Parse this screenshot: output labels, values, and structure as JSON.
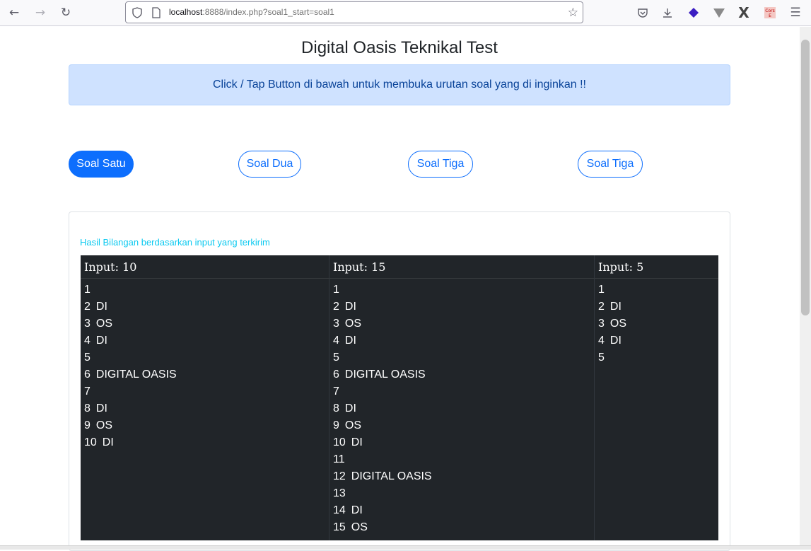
{
  "browser": {
    "url_host": "localhost",
    "url_rest": ":8888/index.php?soal1_start=soal1"
  },
  "page": {
    "title": "Digital Oasis Teknikal Test",
    "alert": "Click / Tap Button di bawah untuk membuka urutan soal yang di inginkan !!",
    "buttons": [
      {
        "label": "Soal Satu",
        "active": true
      },
      {
        "label": "Soal Dua",
        "active": false
      },
      {
        "label": "Soal Tiga",
        "active": false
      },
      {
        "label": "Soal Tiga",
        "active": false
      }
    ],
    "result_caption": "Hasil Bilangan berdasarkan input yang terkirim",
    "columns": [
      {
        "header": "Input: 10",
        "rows": [
          {
            "n": "1",
            "w": ""
          },
          {
            "n": "2",
            "w": "DI"
          },
          {
            "n": "3",
            "w": "OS"
          },
          {
            "n": "4",
            "w": "DI"
          },
          {
            "n": "5",
            "w": ""
          },
          {
            "n": "6",
            "w": "DIGITAL OASIS"
          },
          {
            "n": "7",
            "w": ""
          },
          {
            "n": "8",
            "w": "DI"
          },
          {
            "n": "9",
            "w": "OS"
          },
          {
            "n": "10",
            "w": "DI"
          }
        ]
      },
      {
        "header": "Input: 15",
        "rows": [
          {
            "n": "1",
            "w": ""
          },
          {
            "n": "2",
            "w": "DI"
          },
          {
            "n": "3",
            "w": "OS"
          },
          {
            "n": "4",
            "w": "DI"
          },
          {
            "n": "5",
            "w": ""
          },
          {
            "n": "6",
            "w": "DIGITAL OASIS"
          },
          {
            "n": "7",
            "w": ""
          },
          {
            "n": "8",
            "w": "DI"
          },
          {
            "n": "9",
            "w": "OS"
          },
          {
            "n": "10",
            "w": "DI"
          },
          {
            "n": "11",
            "w": ""
          },
          {
            "n": "12",
            "w": "DIGITAL OASIS"
          },
          {
            "n": "13",
            "w": ""
          },
          {
            "n": "14",
            "w": "DI"
          },
          {
            "n": "15",
            "w": "OS"
          }
        ]
      },
      {
        "header": "Input: 5",
        "rows": [
          {
            "n": "1",
            "w": ""
          },
          {
            "n": "2",
            "w": "DI"
          },
          {
            "n": "3",
            "w": "OS"
          },
          {
            "n": "4",
            "w": "DI"
          },
          {
            "n": "5",
            "w": ""
          }
        ]
      }
    ]
  }
}
